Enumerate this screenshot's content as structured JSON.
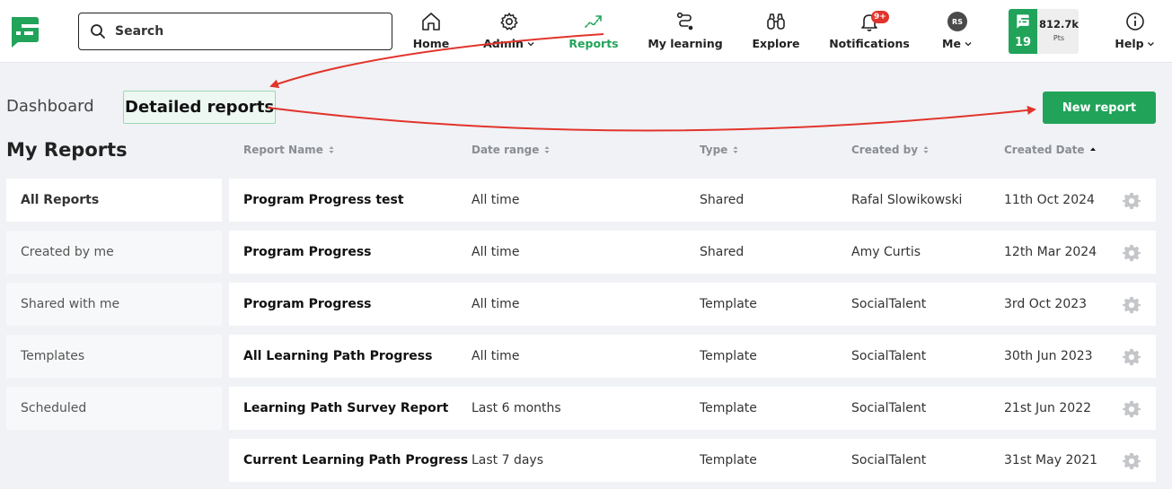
{
  "search": {
    "placeholder": "Search"
  },
  "nav": {
    "home": "Home",
    "admin": "Admin",
    "reports": "Reports",
    "my_learning": "My learning",
    "explore": "Explore",
    "notifications": "Notifications",
    "notifications_badge": "9+",
    "me": "Me",
    "avatar_initials": "RS",
    "help": "Help"
  },
  "points": {
    "level": "19",
    "value": "812.7k",
    "label": "Pts"
  },
  "tabs": {
    "dashboard": "Dashboard",
    "detailed": "Detailed reports"
  },
  "new_report_label": "New report",
  "page_title": "My Reports",
  "sidebar": [
    {
      "label": "All Reports",
      "active": true
    },
    {
      "label": "Created by me",
      "active": false
    },
    {
      "label": "Shared with me",
      "active": false
    },
    {
      "label": "Templates",
      "active": false
    },
    {
      "label": "Scheduled",
      "active": false
    }
  ],
  "table": {
    "columns": [
      "Report Name",
      "Date range",
      "Type",
      "Created by",
      "Created Date"
    ],
    "rows": [
      [
        "Program Progress test",
        "All time",
        "Shared",
        "Rafal Slowikowski",
        "11th Oct 2024"
      ],
      [
        "Program Progress",
        "All time",
        "Shared",
        "Amy Curtis",
        "12th Mar 2024"
      ],
      [
        "Program Progress",
        "All time",
        "Template",
        "SocialTalent",
        "3rd Oct 2023"
      ],
      [
        "All Learning Path Progress",
        "All time",
        "Template",
        "SocialTalent",
        "30th Jun 2023"
      ],
      [
        "Learning Path Survey Report",
        "Last 6 months",
        "Template",
        "SocialTalent",
        "21st Jun 2022"
      ],
      [
        "Current Learning Path Progress",
        "Last 7 days",
        "Template",
        "SocialTalent",
        "31st May 2021"
      ]
    ]
  },
  "colors": {
    "brand_green": "#21a35a",
    "annotation_red": "#e2342c"
  }
}
